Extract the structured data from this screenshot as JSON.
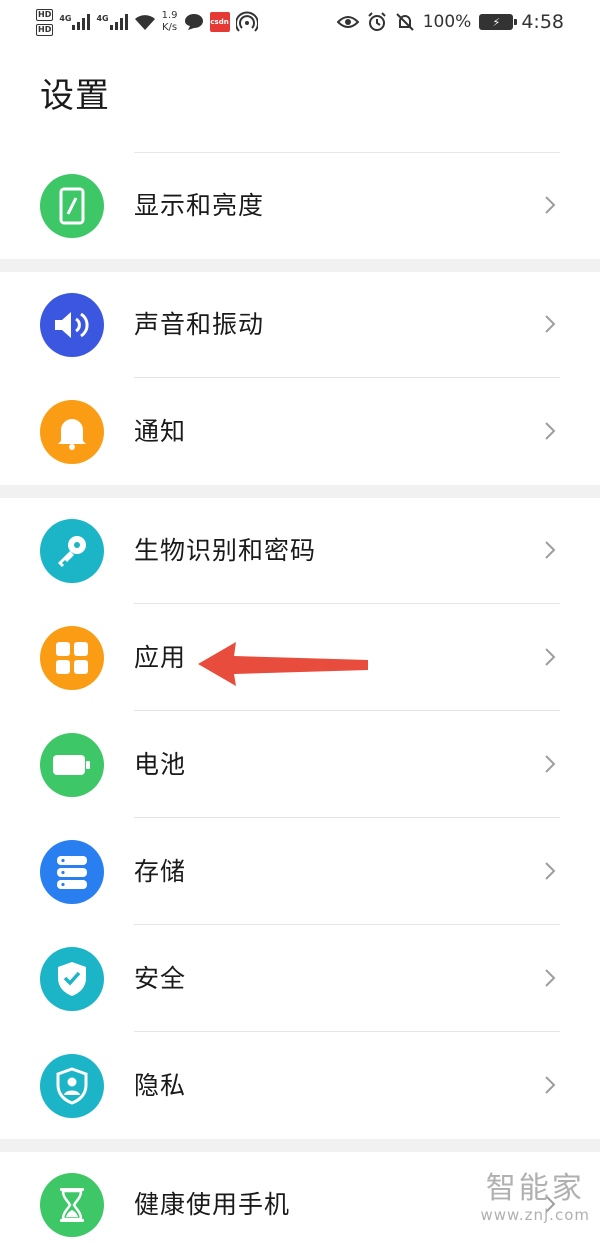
{
  "status_bar": {
    "hd_top": "HD",
    "hd_bottom": "HD",
    "sig1_type": "4G",
    "sig2_type": "4G",
    "speed_value": "1.9",
    "speed_unit": "K/s",
    "csdn_label": "csdn",
    "battery_percent": "100%",
    "time": "4:58"
  },
  "page": {
    "title": "设置"
  },
  "items": [
    {
      "label": "显示和亮度",
      "color": "#3dc767",
      "icon": "phone-brightness-icon"
    },
    {
      "label": "声音和振动",
      "color": "#3b57e0",
      "icon": "speaker-icon"
    },
    {
      "label": "通知",
      "color": "#fa9d14",
      "icon": "bell-icon"
    },
    {
      "label": "生物识别和密码",
      "color": "#1cb5c8",
      "icon": "key-icon"
    },
    {
      "label": "应用",
      "color": "#fa9d14",
      "icon": "apps-grid-icon"
    },
    {
      "label": "电池",
      "color": "#3dc767",
      "icon": "battery-icon"
    },
    {
      "label": "存储",
      "color": "#2a7ff0",
      "icon": "storage-icon"
    },
    {
      "label": "安全",
      "color": "#1cb5c8",
      "icon": "shield-check-icon"
    },
    {
      "label": "隐私",
      "color": "#1cb5c8",
      "icon": "privacy-shield-icon"
    },
    {
      "label": "健康使用手机",
      "color": "#3dc767",
      "icon": "hourglass-icon"
    }
  ],
  "annotation": {
    "arrow_color": "#e74c3c"
  },
  "watermark": {
    "brand": "智能家",
    "url": "www.znj.com"
  }
}
